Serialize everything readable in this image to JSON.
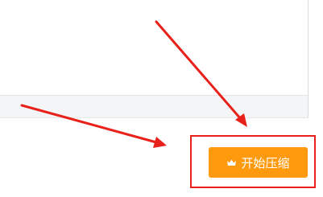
{
  "action_button": {
    "label": "开始压缩",
    "icon": "crown-icon",
    "color": "#ff9a0f",
    "text_color": "#ffffff"
  },
  "annotation": {
    "color": "#e8221b"
  }
}
